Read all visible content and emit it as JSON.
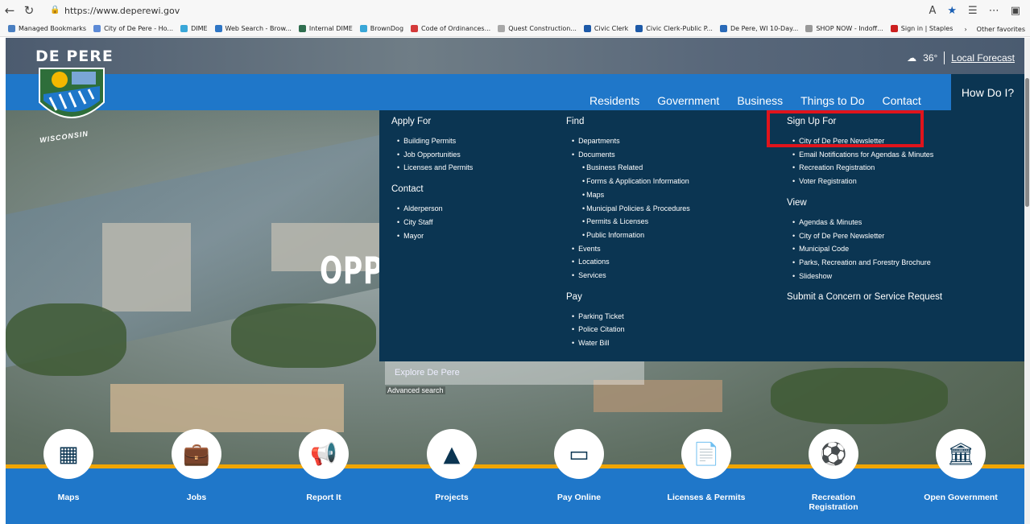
{
  "browser": {
    "url": "https://www.deperewi.gov",
    "bookmarks": [
      {
        "label": "Managed Bookmarks",
        "color": "#4a7fc1"
      },
      {
        "label": "City of De Pere - Ho...",
        "color": "#5c8ad6"
      },
      {
        "label": "DIME",
        "color": "#3aa7d8"
      },
      {
        "label": "Web Search - Brow...",
        "color": "#2f76c5"
      },
      {
        "label": "Internal DIME",
        "color": "#2f6e4f"
      },
      {
        "label": "BrownDog",
        "color": "#3aa7d8"
      },
      {
        "label": "Code of Ordinances...",
        "color": "#d43a3a"
      },
      {
        "label": "Quest Construction...",
        "color": "#a8a8a8"
      },
      {
        "label": "Civic Clerk",
        "color": "#1e5aa8"
      },
      {
        "label": "Civic Clerk-Public P...",
        "color": "#1e5aa8"
      },
      {
        "label": "De Pere, WI 10-Day...",
        "color": "#2a6ab8"
      },
      {
        "label": "SHOP NOW - Indoff...",
        "color": "#999"
      },
      {
        "label": "Sign in | Staples",
        "color": "#cc1f1f"
      }
    ],
    "other_favorites": "Other favorites"
  },
  "header": {
    "brand": "DE PERE",
    "seal_text": "WISCONSIN",
    "weather_temp": "36°",
    "forecast_link": "Local Forecast",
    "nav": [
      "Residents",
      "Government",
      "Business",
      "Things to Do",
      "Contact"
    ],
    "how_do_i": "How Do I?"
  },
  "mega_menu": {
    "apply_for": {
      "title": "Apply For",
      "items": [
        "Building Permits",
        "Job Opportunities",
        "Licenses and Permits"
      ]
    },
    "contact": {
      "title": "Contact",
      "items": [
        "Alderperson",
        "City Staff",
        "Mayor"
      ]
    },
    "find": {
      "title": "Find",
      "items": [
        "Departments",
        "Documents"
      ],
      "documents_sub": [
        "Business Related",
        "Forms & Application Information",
        "Maps",
        "Municipal Policies & Procedures",
        "Permits & Licenses",
        "Public Information"
      ],
      "items2": [
        "Events",
        "Locations",
        "Services"
      ]
    },
    "pay": {
      "title": "Pay",
      "items": [
        "Parking Ticket",
        "Police Citation",
        "Water Bill"
      ]
    },
    "sign_up_for": {
      "title": "Sign Up For",
      "items": [
        "City of De Pere Newsletter",
        "Email Notifications for Agendas & Minutes",
        "Recreation Registration",
        "Voter Registration"
      ]
    },
    "view": {
      "title": "View",
      "items": [
        "Agendas & Minutes",
        "City of De Pere Newsletter",
        "Municipal Code",
        "Parks, Recreation and Forestry Brochure",
        "Slideshow"
      ]
    },
    "submit": "Submit a Concern or Service Request"
  },
  "hero": {
    "partial_text": "OPP",
    "search_placeholder": "Explore De Pere",
    "advanced_search": "Advanced search"
  },
  "quick_links": [
    {
      "label": "Maps",
      "icon": "map-icon",
      "glyph": "▦"
    },
    {
      "label": "Jobs",
      "icon": "briefcase-icon",
      "glyph": "💼"
    },
    {
      "label": "Report It",
      "icon": "megaphone-icon",
      "glyph": "📢"
    },
    {
      "label": "Projects",
      "icon": "traffic-cone-icon",
      "glyph": "▲"
    },
    {
      "label": "Pay Online",
      "icon": "credit-card-icon",
      "glyph": "▭"
    },
    {
      "label": "Licenses & Permits",
      "icon": "document-icon",
      "glyph": "📄"
    },
    {
      "label": "Recreation Registration",
      "icon": "soccer-ball-icon",
      "glyph": "⚽"
    },
    {
      "label": "Open Government",
      "icon": "government-building-icon",
      "glyph": "🏛"
    }
  ],
  "colors": {
    "brand_blue": "#1f77c9",
    "menu_navy": "#0b3552",
    "accent_gold": "#f0a500",
    "highlight_red": "#e0141c"
  }
}
